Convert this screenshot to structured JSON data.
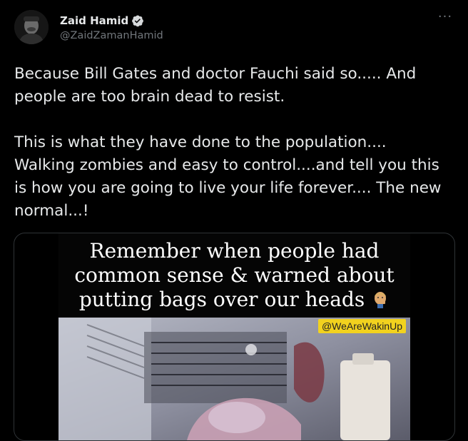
{
  "author": {
    "name": "Zaid Hamid",
    "handle": "@ZaidZamanHamid"
  },
  "menu_label": "···",
  "tweet_text": {
    "para1_line1": "Because Bill Gates and doctor Fauchi said so..... And",
    "para1_line2": "people are too brain dead to resist.",
    "para2_line1": "This is what they have done to the population....",
    "para2_line2": "Walking zombies and easy to control....and tell you this",
    "para2_line3": "is how you are going to live your life forever.... The new",
    "para2_line4": "normal...!"
  },
  "media": {
    "caption_line1": "Remember when people had",
    "caption_line2": "common sense & warned about",
    "caption_line3": "putting bags over our heads",
    "watermark": "@WeAreWakinUp"
  },
  "colors": {
    "background": "#000000",
    "text": "#e7e9ea",
    "secondary": "#71767b",
    "verified": "#d6d9db",
    "watermark_bg": "#f2d21e"
  }
}
